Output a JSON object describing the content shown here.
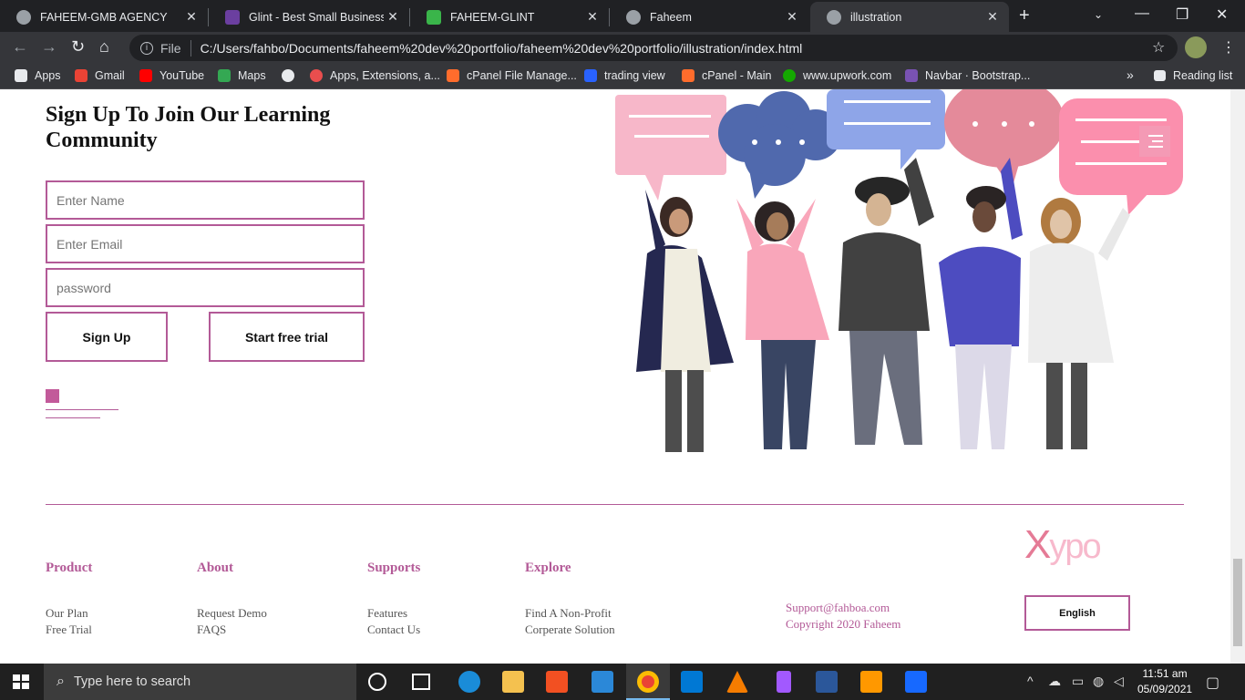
{
  "browser": {
    "tabs": [
      {
        "title": "FAHEEM-GMB AGENCY",
        "close": "✕",
        "color": "#9aa0a6"
      },
      {
        "title": "Glint - Best Small Business W",
        "close": "✕",
        "color": "#6b3fa0"
      },
      {
        "title": "FAHEEM-GLINT",
        "close": "✕",
        "color": "#3ab54a"
      },
      {
        "title": "Faheem",
        "close": "✕",
        "color": "#9aa0a6"
      },
      {
        "title": "illustration",
        "close": "✕",
        "color": "#9aa0a6"
      }
    ],
    "new_tab": "+",
    "address": {
      "info": "i",
      "scheme": "File",
      "url": "C:/Users/fahbo/Documents/faheem%20dev%20portfolio/faheem%20dev%20portfolio/illustration/index.html"
    },
    "bookmarks": [
      {
        "label": "Apps",
        "color": "#ea4335"
      },
      {
        "label": "Gmail",
        "color": "#ea4335"
      },
      {
        "label": "YouTube",
        "color": "#ff0000"
      },
      {
        "label": "Maps",
        "color": "#34a853"
      },
      {
        "label": "",
        "color": "#e8eaed"
      },
      {
        "label": "Apps, Extensions, a...",
        "color": "#e94e4e"
      },
      {
        "label": "cPanel File Manage...",
        "color": "#ff6c2c"
      },
      {
        "label": "trading view",
        "color": "#2962ff"
      },
      {
        "label": "cPanel - Main",
        "color": "#ff6c2c"
      },
      {
        "label": "www.upwork.com",
        "color": "#14a800"
      },
      {
        "label": "Navbar · Bootstrap...",
        "color": "#7952b3"
      }
    ],
    "more": "»",
    "reading_list": "Reading list"
  },
  "signup": {
    "heading": "Sign Up To Join Our Learning Community",
    "name_placeholder": "Enter Name",
    "email_placeholder": "Enter Email",
    "password_placeholder": "password",
    "signup_label": "Sign Up",
    "trial_label": "Start free trial"
  },
  "footer": {
    "columns": [
      {
        "title": "Product",
        "links": [
          "Our Plan",
          "Free Trial"
        ]
      },
      {
        "title": "About",
        "links": [
          "Request Demo",
          "FAQS"
        ]
      },
      {
        "title": "Supports",
        "links": [
          "Features",
          "Contact Us"
        ]
      },
      {
        "title": "Explore",
        "links": [
          "Find A Non-Profit",
          "Corperate Solution"
        ]
      }
    ],
    "email": "Support@fahboa.com",
    "copyright": "Copyright 2020 Faheem",
    "logo_x": "X",
    "logo_rest": "ypo",
    "language": "English"
  },
  "taskbar": {
    "search_placeholder": "Type here to search",
    "time": "11:51 am",
    "date": "05/09/2021"
  },
  "colors": {
    "accent": "#b35a97",
    "pink": "#f49ab5"
  }
}
